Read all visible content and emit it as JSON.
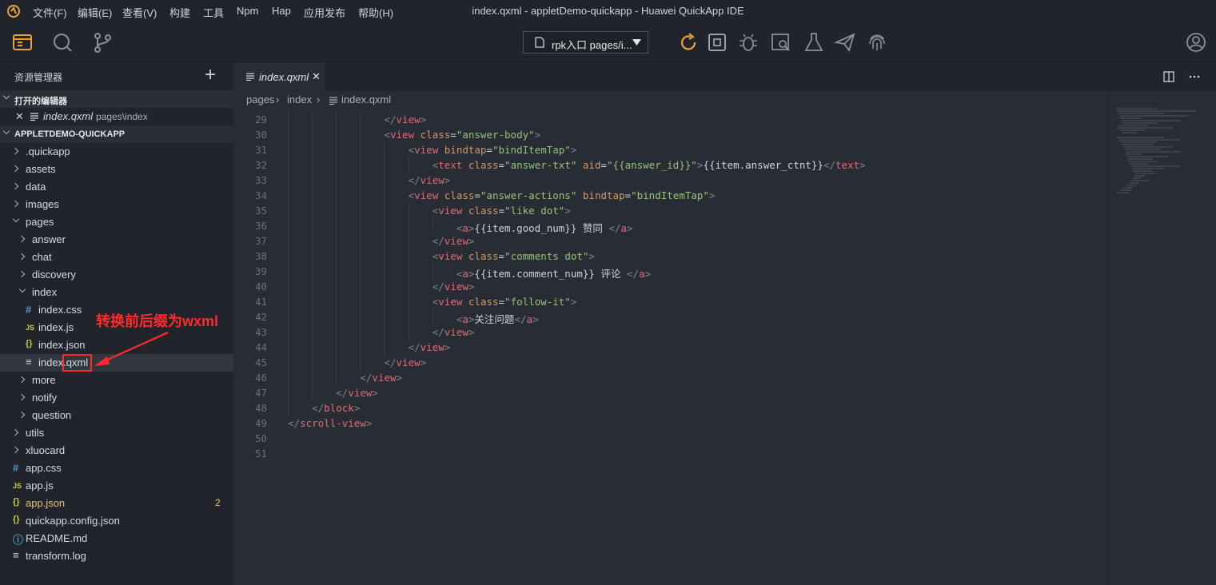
{
  "titlebar": {
    "menu": [
      "文件(F)",
      "编辑(E)",
      "查看(V)",
      "构建",
      "工具",
      "Npm",
      "Hap",
      "应用发布",
      "帮助(H)"
    ],
    "title": "index.qxml - appletDemo-quickapp - Huawei QuickApp IDE"
  },
  "toolbar": {
    "run_select": "rpk入口 pages/i...",
    "icons": [
      "explorer-icon",
      "search-icon",
      "source-control-icon",
      "reload-icon",
      "stop-icon",
      "debug-icon",
      "inspect-icon",
      "test-icon",
      "send-icon",
      "fingerprint-icon",
      "account-icon"
    ]
  },
  "sidebar": {
    "header": "资源管理器",
    "add": "+",
    "open_editors_title": "打开的编辑器",
    "open_editor": {
      "name": "index.qxml",
      "path": "pages\\index"
    },
    "project_title": "APPLETDEMO-QUICKAPP",
    "tree": [
      {
        "label": ".quickapp",
        "kind": "folder",
        "indent": 0,
        "open": false
      },
      {
        "label": "assets",
        "kind": "folder",
        "indent": 0,
        "open": false
      },
      {
        "label": "data",
        "kind": "folder",
        "indent": 0,
        "open": false
      },
      {
        "label": "images",
        "kind": "folder",
        "indent": 0,
        "open": false
      },
      {
        "label": "pages",
        "kind": "folder",
        "indent": 0,
        "open": true
      },
      {
        "label": "answer",
        "kind": "folder",
        "indent": 1,
        "open": false
      },
      {
        "label": "chat",
        "kind": "folder",
        "indent": 1,
        "open": false
      },
      {
        "label": "discovery",
        "kind": "folder",
        "indent": 1,
        "open": false
      },
      {
        "label": "index",
        "kind": "folder",
        "indent": 1,
        "open": true
      },
      {
        "label": "index.css",
        "kind": "css",
        "indent": 2
      },
      {
        "label": "index.js",
        "kind": "js",
        "indent": 2
      },
      {
        "label": "index.json",
        "kind": "json",
        "indent": 2
      },
      {
        "label": "index.qxml",
        "kind": "text",
        "indent": 2,
        "selected": true
      },
      {
        "label": "more",
        "kind": "folder",
        "indent": 1,
        "open": false
      },
      {
        "label": "notify",
        "kind": "folder",
        "indent": 1,
        "open": false
      },
      {
        "label": "question",
        "kind": "folder",
        "indent": 1,
        "open": false
      },
      {
        "label": "utils",
        "kind": "folder",
        "indent": 0,
        "open": false
      },
      {
        "label": "xluocard",
        "kind": "folder",
        "indent": 0,
        "open": false
      },
      {
        "label": "app.css",
        "kind": "css",
        "indent": 0
      },
      {
        "label": "app.js",
        "kind": "js",
        "indent": 0
      },
      {
        "label": "app.json",
        "kind": "json",
        "indent": 0,
        "modified": true,
        "badge": "2"
      },
      {
        "label": "quickapp.config.json",
        "kind": "json",
        "indent": 0
      },
      {
        "label": "README.md",
        "kind": "info",
        "indent": 0
      },
      {
        "label": "transform.log",
        "kind": "text",
        "indent": 0
      }
    ]
  },
  "annotation": {
    "text": "转换前后缀为wxml",
    "color": "#ff2a2a"
  },
  "editor": {
    "tab": "index.qxml",
    "close": "✕",
    "breadcrumb": [
      "pages",
      "index",
      "index.qxml"
    ],
    "lines": [
      {
        "n": "29",
        "indent": 4,
        "tokens": [
          [
            "br",
            "</"
          ],
          [
            "tg",
            "view"
          ],
          [
            "br",
            ">"
          ]
        ]
      },
      {
        "n": "30",
        "indent": 4,
        "tokens": [
          [
            "br",
            "<"
          ],
          [
            "tg",
            "view"
          ],
          [
            "tx",
            " "
          ],
          [
            "at",
            "class"
          ],
          [
            "tx",
            "="
          ],
          [
            "st",
            "\"answer-body\""
          ],
          [
            "br",
            ">"
          ]
        ]
      },
      {
        "n": "31",
        "indent": 5,
        "tokens": [
          [
            "br",
            "<"
          ],
          [
            "tg",
            "view"
          ],
          [
            "tx",
            " "
          ],
          [
            "at",
            "bindtap"
          ],
          [
            "tx",
            "="
          ],
          [
            "st",
            "\"bindItemTap\""
          ],
          [
            "br",
            ">"
          ]
        ]
      },
      {
        "n": "32",
        "indent": 6,
        "tokens": [
          [
            "br",
            "<"
          ],
          [
            "tg",
            "text"
          ],
          [
            "tx",
            " "
          ],
          [
            "at",
            "class"
          ],
          [
            "tx",
            "="
          ],
          [
            "st",
            "\"answer-txt\""
          ],
          [
            "tx",
            " "
          ],
          [
            "at",
            "aid"
          ],
          [
            "tx",
            "="
          ],
          [
            "st",
            "\"{{answer_id}}\""
          ],
          [
            "br",
            ">"
          ],
          [
            "tx",
            "{{item.answer_ctnt}}"
          ],
          [
            "br",
            "</"
          ],
          [
            "tg",
            "text"
          ],
          [
            "br",
            ">"
          ]
        ]
      },
      {
        "n": "33",
        "indent": 5,
        "tokens": [
          [
            "br",
            "</"
          ],
          [
            "tg",
            "view"
          ],
          [
            "br",
            ">"
          ]
        ]
      },
      {
        "n": "34",
        "indent": 5,
        "tokens": [
          [
            "br",
            "<"
          ],
          [
            "tg",
            "view"
          ],
          [
            "tx",
            " "
          ],
          [
            "at",
            "class"
          ],
          [
            "tx",
            "="
          ],
          [
            "st",
            "\"answer-actions\""
          ],
          [
            "tx",
            " "
          ],
          [
            "at",
            "bindtap"
          ],
          [
            "tx",
            "="
          ],
          [
            "st",
            "\"bindItemTap\""
          ],
          [
            "br",
            ">"
          ]
        ]
      },
      {
        "n": "35",
        "indent": 6,
        "tokens": [
          [
            "br",
            "<"
          ],
          [
            "tg",
            "view"
          ],
          [
            "tx",
            " "
          ],
          [
            "at",
            "class"
          ],
          [
            "tx",
            "="
          ],
          [
            "st",
            "\"like dot\""
          ],
          [
            "br",
            ">"
          ]
        ]
      },
      {
        "n": "36",
        "indent": 7,
        "tokens": [
          [
            "br",
            "<"
          ],
          [
            "tg",
            "a"
          ],
          [
            "br",
            ">"
          ],
          [
            "tx",
            "{{item.good_num}} 赞同 "
          ],
          [
            "br",
            "</"
          ],
          [
            "tg",
            "a"
          ],
          [
            "br",
            ">"
          ]
        ]
      },
      {
        "n": "37",
        "indent": 6,
        "tokens": [
          [
            "br",
            "</"
          ],
          [
            "tg",
            "view"
          ],
          [
            "br",
            ">"
          ]
        ]
      },
      {
        "n": "38",
        "indent": 6,
        "tokens": [
          [
            "br",
            "<"
          ],
          [
            "tg",
            "view"
          ],
          [
            "tx",
            " "
          ],
          [
            "at",
            "class"
          ],
          [
            "tx",
            "="
          ],
          [
            "st",
            "\"comments dot\""
          ],
          [
            "br",
            ">"
          ]
        ]
      },
      {
        "n": "39",
        "indent": 7,
        "tokens": [
          [
            "br",
            "<"
          ],
          [
            "tg",
            "a"
          ],
          [
            "br",
            ">"
          ],
          [
            "tx",
            "{{item.comment_num}} 评论 "
          ],
          [
            "br",
            "</"
          ],
          [
            "tg",
            "a"
          ],
          [
            "br",
            ">"
          ]
        ]
      },
      {
        "n": "40",
        "indent": 6,
        "tokens": [
          [
            "br",
            "</"
          ],
          [
            "tg",
            "view"
          ],
          [
            "br",
            ">"
          ]
        ]
      },
      {
        "n": "41",
        "indent": 6,
        "tokens": [
          [
            "br",
            "<"
          ],
          [
            "tg",
            "view"
          ],
          [
            "tx",
            " "
          ],
          [
            "at",
            "class"
          ],
          [
            "tx",
            "="
          ],
          [
            "st",
            "\"follow-it\""
          ],
          [
            "br",
            ">"
          ]
        ]
      },
      {
        "n": "42",
        "indent": 7,
        "tokens": [
          [
            "br",
            "<"
          ],
          [
            "tg",
            "a"
          ],
          [
            "br",
            ">"
          ],
          [
            "tx",
            "关注问题"
          ],
          [
            "br",
            "</"
          ],
          [
            "tg",
            "a"
          ],
          [
            "br",
            ">"
          ]
        ]
      },
      {
        "n": "43",
        "indent": 6,
        "tokens": [
          [
            "br",
            "</"
          ],
          [
            "tg",
            "view"
          ],
          [
            "br",
            ">"
          ]
        ]
      },
      {
        "n": "44",
        "indent": 5,
        "tokens": [
          [
            "br",
            "</"
          ],
          [
            "tg",
            "view"
          ],
          [
            "br",
            ">"
          ]
        ]
      },
      {
        "n": "45",
        "indent": 4,
        "tokens": [
          [
            "br",
            "</"
          ],
          [
            "tg",
            "view"
          ],
          [
            "br",
            ">"
          ]
        ]
      },
      {
        "n": "46",
        "indent": 3,
        "tokens": [
          [
            "br",
            "</"
          ],
          [
            "tg",
            "view"
          ],
          [
            "br",
            ">"
          ]
        ]
      },
      {
        "n": "47",
        "indent": 2,
        "tokens": [
          [
            "br",
            "</"
          ],
          [
            "tg",
            "view"
          ],
          [
            "br",
            ">"
          ]
        ]
      },
      {
        "n": "48",
        "indent": 1,
        "tokens": [
          [
            "br",
            "</"
          ],
          [
            "tg",
            "block"
          ],
          [
            "br",
            ">"
          ]
        ]
      },
      {
        "n": "49",
        "indent": 0,
        "tokens": [
          [
            "br",
            "</"
          ],
          [
            "tg",
            "scroll-view"
          ],
          [
            "br",
            ">"
          ]
        ]
      },
      {
        "n": "50",
        "indent": 0,
        "tokens": []
      },
      {
        "n": "51",
        "indent": 0,
        "tokens": []
      }
    ]
  },
  "colors": {
    "accent": "#e8a33d",
    "folder_chevron": "#aab0bb",
    "css_icon": "#519aba",
    "js_icon": "#cbcb41",
    "json_icon": "#cbcb41",
    "modified": "#e5c07b"
  }
}
